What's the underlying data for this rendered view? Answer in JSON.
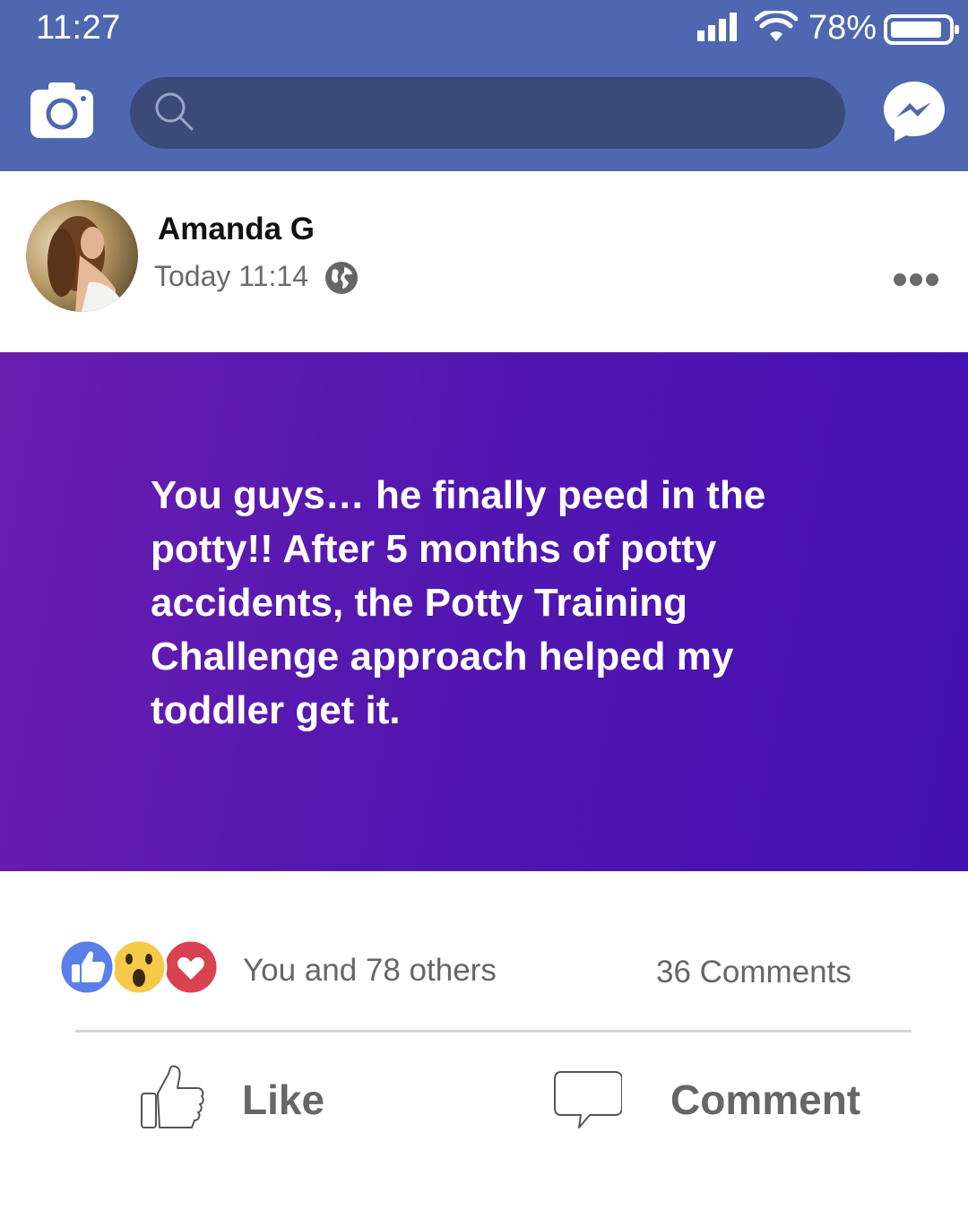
{
  "status_bar": {
    "time": "11:27",
    "battery_percent": "78%"
  },
  "top_bar": {
    "search_placeholder": ""
  },
  "post": {
    "author": "Amanda G",
    "timestamp": "Today 11:14",
    "text": "You guys… he finally peed in the potty!! After 5 months of potty accidents, the Potty Training Challenge approach helped my toddler get it.",
    "reactions_text": "You and 78 others",
    "comments_text": "36 Comments",
    "reaction_icons": [
      "like-icon",
      "wow-icon",
      "love-icon"
    ]
  },
  "actions": {
    "like_label": "Like",
    "comment_label": "Comment"
  },
  "colors": {
    "top_bar": "#4f67b0",
    "search_bar": "#3a4b7a",
    "post_gradient_start": "#6a1eb0",
    "post_gradient_end": "#4310b2"
  }
}
